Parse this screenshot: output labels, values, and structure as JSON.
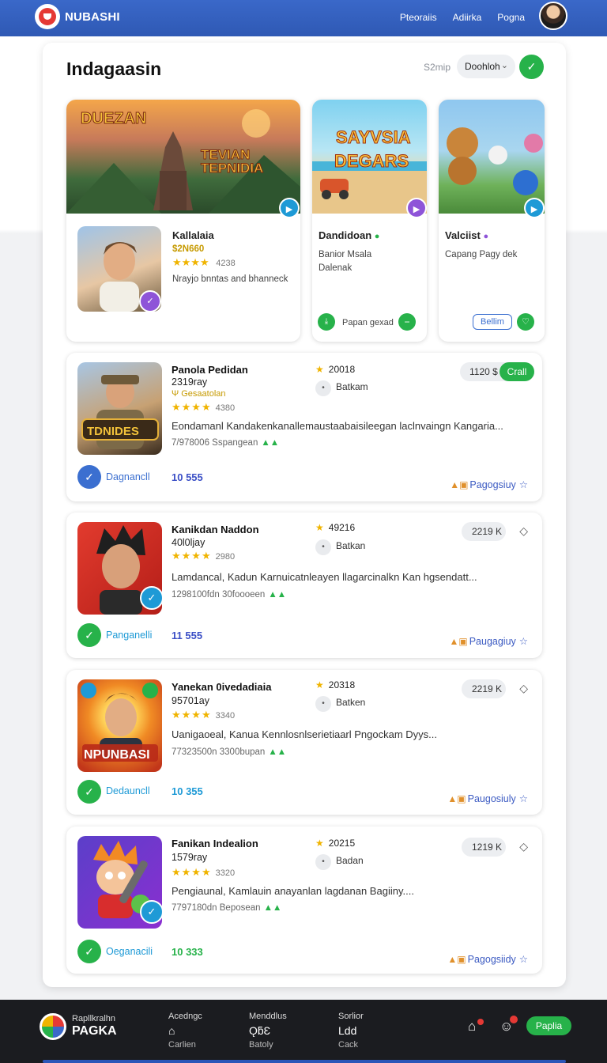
{
  "header": {
    "brand": "NUBASHI",
    "nav": [
      "Pteoraiis",
      "Adiirka",
      "Pogna"
    ]
  },
  "panel": {
    "title": "Indagaasin",
    "sort_label": "S2mip",
    "sort_value": "Doohloh"
  },
  "featured": [
    {
      "name": "Kallalaia",
      "price": "$2N660",
      "stars": "★★★★",
      "count": "4238",
      "desc": "Nrayjo bnntas and bhanneck",
      "art_text": "DUEZAN\nTEVIAN\nTEPNIDIA"
    },
    {
      "name": "Dandidoan",
      "line1": "Banior Msala",
      "line2": "Dalenak",
      "btn": "Papan gexad",
      "art_text": "SAYVSIA\nDEGARS"
    },
    {
      "name": "Valciist",
      "desc": "Capang Pagy dek",
      "btn": "Bellim"
    }
  ],
  "apps": [
    {
      "title": "Panola Pedidan",
      "sub": "2319ray",
      "tagline": "Ψ Gesaatolan",
      "stars": "★★★★",
      "count": "4380",
      "rank": "20018",
      "category": "Batkam",
      "desc": "Eondamanl Kandakenkanallemaustaabaisileegan laclnvaingn Kangaria...",
      "meta": "7/978006 Sspangean",
      "status": "Dagnancll",
      "downloads": "10 555",
      "price": "1120 $",
      "get": "Crall",
      "rec": "Pagogsiuy",
      "status_color": "#3b6fd0",
      "dl_color": "#3b4fc6"
    },
    {
      "title": "Kanikdan Naddon",
      "sub": "40l0ljay",
      "stars": "★★★★",
      "count": "2980",
      "rank": "49216",
      "category": "Batkan",
      "desc": "Lamdancal, Kadun Karnuicatnleayen llagarcinalkn Kan hgsendatt...",
      "meta": "1298100fdn 30foooeen",
      "status": "Panganelli",
      "downloads": "11 555",
      "price": "2219 K",
      "rec": "Paugagiuy",
      "status_color": "#27b24a",
      "dl_color": "#3b4fc6"
    },
    {
      "title": "Yanekan 0ivedadiaia",
      "sub": "95701ay",
      "stars": "★★★★",
      "count": "3340",
      "rank": "20318",
      "category": "Batken",
      "desc": "Uanigaoeal, Kanua Kennlosnlserietiaarl Pngockam Dyys...",
      "meta": "77323500n 3300bupan",
      "status": "Dedauncll",
      "downloads": "10 355",
      "price": "2219 K",
      "rec": "Paugosiuly",
      "status_color": "#27b24a",
      "dl_color": "#1e9ad6"
    },
    {
      "title": "Fanikan Indealion",
      "sub": "1579ray",
      "stars": "★★★★",
      "count": "3320",
      "rank": "20215",
      "category": "Badan",
      "desc": "Pengiaunal, Kamlauin anayanlan lagdanan Bagiiny....",
      "meta": "7797180dn Beposean",
      "status": "Oeganacili",
      "downloads": "10 333",
      "price": "1219 K",
      "rec": "Pagogsiidy",
      "status_color": "#27b24a",
      "dl_color": "#27b24a"
    }
  ],
  "footer": {
    "small": "Rapllkralhn",
    "brand": "PAGKA",
    "cols": [
      {
        "head": "Acedngc",
        "icon": "⌂",
        "label": "Carlien"
      },
      {
        "head": "Menddlus",
        "icon": "ǪƃƐ",
        "label": "Batoly"
      },
      {
        "head": "Sorlior",
        "icon": "Ldd",
        "label": "Cack"
      }
    ],
    "btn": "Paplia"
  },
  "colors": {
    "header_blue": "#3a68c9",
    "accent_green": "#27b24a",
    "purple": "#8e54d8",
    "star": "#f0b400"
  }
}
